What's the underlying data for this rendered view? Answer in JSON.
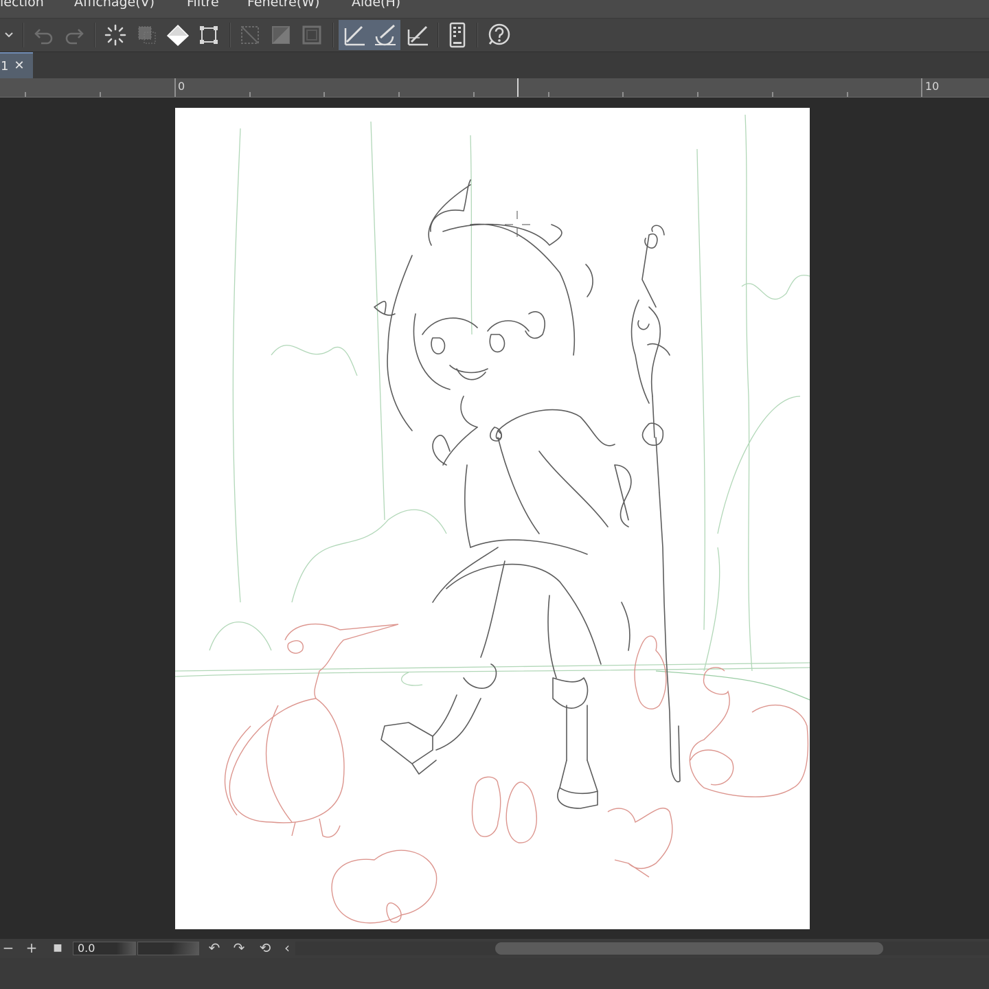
{
  "menu": {
    "items": [
      {
        "id": "selection",
        "label": "lection"
      },
      {
        "id": "view",
        "label": "Affichage(V)"
      },
      {
        "id": "filter",
        "label": "Filtre"
      },
      {
        "id": "window",
        "label": "Fenêtre(W)"
      },
      {
        "id": "help",
        "label": "Aide(H)"
      }
    ]
  },
  "toolbar": {
    "buttons": [
      "chevron-down-icon",
      "undo-icon",
      "redo-icon",
      "loading-icon",
      "clear-selection-icon",
      "fill-icon",
      "transform-icon",
      "hide-selection-icon",
      "invert-selection-icon",
      "border-icon",
      "snap-ruler-icon",
      "snap-special-ruler-icon",
      "snap-grid-icon",
      "device-icon",
      "help-icon"
    ],
    "active": [
      "snap-ruler-icon",
      "snap-special-ruler-icon"
    ]
  },
  "tabs": [
    {
      "label": "1",
      "close": "✕",
      "active": true
    }
  ],
  "ruler": {
    "labels": [
      "0",
      "10"
    ]
  },
  "canvas": {
    "background": "#ffffff",
    "sketch_colors": {
      "main": "#5a5a5a",
      "green": "#8fc79a",
      "red": "#d47a72"
    }
  },
  "navigator": {
    "zoom_out": "−",
    "zoom_in": "+",
    "fit": "■",
    "zoom_value": "0.0",
    "rotate_left": "↶",
    "rotate_right": "↷",
    "reset_rotation": "⟲",
    "scroll_left": "‹"
  }
}
